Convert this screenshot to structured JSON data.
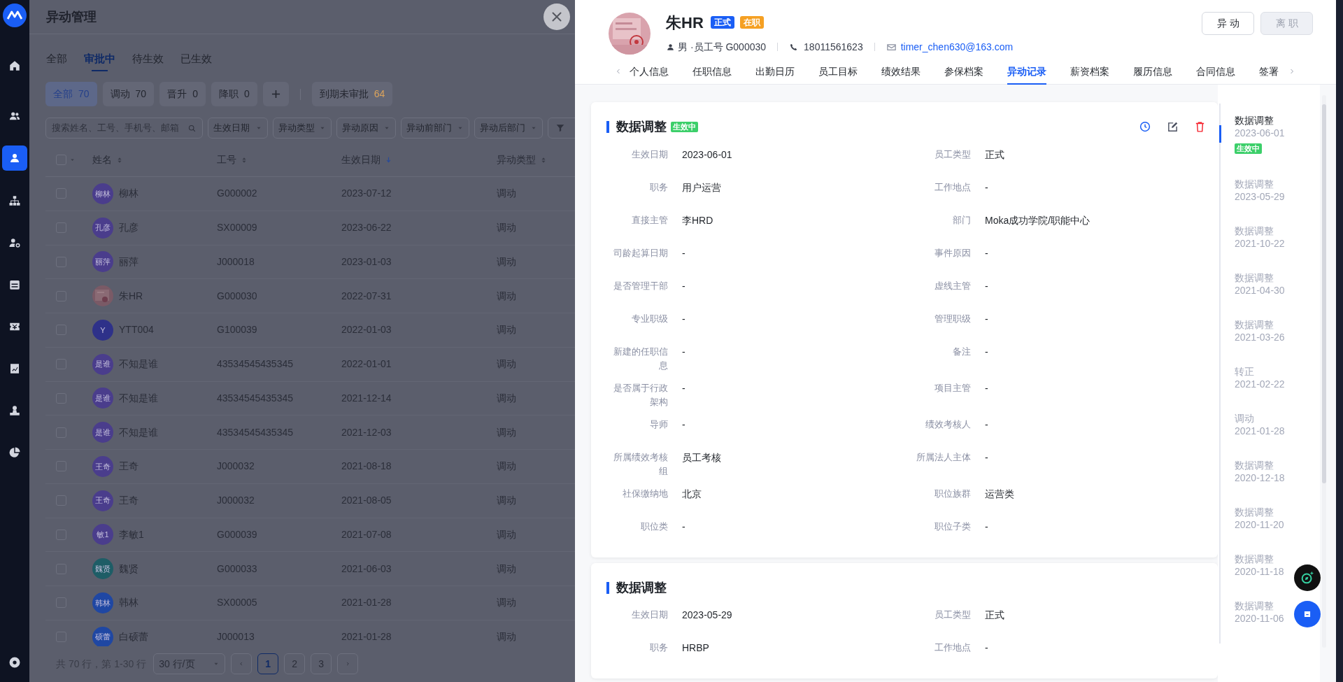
{
  "sidebar": {
    "items": [
      {
        "selected": false
      },
      {
        "selected": false
      },
      {
        "selected": true
      },
      {
        "selected": false
      },
      {
        "selected": false
      },
      {
        "selected": false
      },
      {
        "selected": false
      },
      {
        "selected": false
      },
      {
        "selected": false
      },
      {
        "selected": false
      },
      {
        "selected": false
      }
    ]
  },
  "page": {
    "title": "异动管理",
    "tabs": [
      {
        "label": "全部",
        "selected": false
      },
      {
        "label": "审批中",
        "selected": true
      },
      {
        "label": "待生效",
        "selected": false
      },
      {
        "label": "已生效",
        "selected": false
      }
    ],
    "chips": [
      {
        "label": "全部",
        "count": "70",
        "selected": true,
        "kind": "normal"
      },
      {
        "label": "调动",
        "count": "70",
        "selected": false,
        "kind": "normal"
      },
      {
        "label": "晋升",
        "count": "0",
        "selected": false,
        "kind": "normal"
      },
      {
        "label": "降职",
        "count": "0",
        "selected": false,
        "kind": "normal"
      },
      {
        "label": "到期未审批",
        "count": "64",
        "selected": false,
        "kind": "warning"
      }
    ],
    "search": {
      "placeholder": "搜索姓名、工号、手机号、邮箱"
    },
    "filters": [
      "生效日期",
      "异动类型",
      "异动原因",
      "异动前部门",
      "异动后部门"
    ],
    "table": {
      "select_all": {
        "checked": false
      },
      "columns": [
        {
          "label": "姓名",
          "kind": "sortable"
        },
        {
          "label": "工号",
          "kind": "sortable"
        },
        {
          "label": "生效日期",
          "kind": "sorted"
        },
        {
          "label": "异动类型",
          "kind": "sortable"
        }
      ],
      "rows": [
        {
          "checked": false,
          "avatar": "柳林",
          "color": "#4a3d8c",
          "name": "柳林",
          "id": "G000002",
          "date": "2023-07-12",
          "type": "调动"
        },
        {
          "checked": false,
          "avatar": "孔彦",
          "color": "#4a3d8c",
          "name": "孔彦",
          "id": "SX00009",
          "date": "2023-06-22",
          "type": "调动"
        },
        {
          "checked": false,
          "avatar": "丽萍",
          "color": "#4a3d8c",
          "name": "丽萍",
          "id": "J000018",
          "date": "2023-01-03",
          "type": "调动"
        },
        {
          "checked": false,
          "kind": "picture",
          "name": "朱HR",
          "id": "G000030",
          "date": "2022-07-31",
          "type": "调动"
        },
        {
          "checked": false,
          "avatar": "Y",
          "color": "#2e3189",
          "name": "YTT004",
          "id": "G100039",
          "date": "2022-01-03",
          "type": "调动"
        },
        {
          "checked": false,
          "avatar": "是谁",
          "color": "#4a3d8c",
          "name": "不知是谁",
          "id": "43534545435345",
          "date": "2022-01-01",
          "type": "调动"
        },
        {
          "checked": false,
          "avatar": "是谁",
          "color": "#4a3d8c",
          "name": "不知是谁",
          "id": "43534545435345",
          "date": "2021-12-14",
          "type": "调动"
        },
        {
          "checked": false,
          "avatar": "是谁",
          "color": "#4a3d8c",
          "name": "不知是谁",
          "id": "43534545435345",
          "date": "2021-12-03",
          "type": "调动"
        },
        {
          "checked": false,
          "avatar": "王奇",
          "color": "#4a3d8c",
          "name": "王奇",
          "id": "J000032",
          "date": "2021-08-18",
          "type": "调动"
        },
        {
          "checked": false,
          "avatar": "王奇",
          "color": "#4a3d8c",
          "name": "王奇",
          "id": "J000032",
          "date": "2021-08-05",
          "type": "调动"
        },
        {
          "checked": false,
          "avatar": "敏1",
          "color": "#4a3d8c",
          "name": "李敏1",
          "id": "G000039",
          "date": "2021-07-08",
          "type": "调动"
        },
        {
          "checked": false,
          "avatar": "魏贤",
          "color": "#1e5d66",
          "name": "魏贤",
          "id": "G000033",
          "date": "2021-06-03",
          "type": "调动"
        },
        {
          "checked": false,
          "avatar": "韩林",
          "color": "#1f47a3",
          "name": "韩林",
          "id": "SX00005",
          "date": "2021-01-28",
          "type": "调动"
        },
        {
          "checked": false,
          "avatar": "硕蕾",
          "color": "#1f47a3",
          "name": "白硕蕾",
          "id": "J000013",
          "date": "2021-01-28",
          "type": "调动"
        }
      ]
    },
    "pagination": {
      "summary": "共 70 行，第 1-30 行",
      "page_size": "30 行/页",
      "pages": [
        {
          "label": "1",
          "selected": true
        },
        {
          "label": "2",
          "selected": false
        },
        {
          "label": "3",
          "selected": false
        }
      ]
    }
  },
  "drawer": {
    "name": "朱HR",
    "tags": [
      {
        "label": "正式",
        "color": "#1a5ef5"
      },
      {
        "label": "在职",
        "color": "#f5a023"
      }
    ],
    "info": "男 ·员工号 G000030",
    "phone": "18011561623",
    "email": "timer_chen630@163.com",
    "actions": [
      {
        "label": "异动",
        "disabled": false
      },
      {
        "label": "离职",
        "disabled": true
      }
    ],
    "tabs": [
      {
        "label": "个人信息",
        "selected": false
      },
      {
        "label": "任职信息",
        "selected": false
      },
      {
        "label": "出勤日历",
        "selected": false
      },
      {
        "label": "员工目标",
        "selected": false
      },
      {
        "label": "绩效结果",
        "selected": false
      },
      {
        "label": "参保档案",
        "selected": false
      },
      {
        "label": "异动记录",
        "selected": true
      },
      {
        "label": "薪资档案",
        "selected": false
      },
      {
        "label": "履历信息",
        "selected": false
      },
      {
        "label": "合同信息",
        "selected": false
      },
      {
        "label": "签署",
        "selected": false
      }
    ],
    "records": [
      {
        "title": "数据调整",
        "badge": "生效中",
        "show_actions": true,
        "fields": [
          {
            "label": "生效日期",
            "value": "2023-06-01"
          },
          {
            "label": "员工类型",
            "value": "正式"
          },
          {
            "label": "职务",
            "value": "用户运营"
          },
          {
            "label": "工作地点",
            "value": "-"
          },
          {
            "label": "直接主管",
            "value": "李HRD"
          },
          {
            "label": "部门",
            "value": "Moka成功学院/职能中心"
          },
          {
            "label": "司龄起算日期",
            "value": "-"
          },
          {
            "label": "事件原因",
            "value": "-"
          },
          {
            "label": "是否管理干部",
            "value": "-"
          },
          {
            "label": "虚线主管",
            "value": "-"
          },
          {
            "label": "专业职级",
            "value": "-"
          },
          {
            "label": "管理职级",
            "value": "-"
          },
          {
            "label": "新建的任职信息",
            "value": "-"
          },
          {
            "label": "备注",
            "value": "-"
          },
          {
            "label": "是否属于行政架构",
            "value": "-"
          },
          {
            "label": "项目主管",
            "value": "-"
          },
          {
            "label": "导师",
            "value": "-"
          },
          {
            "label": "绩效考核人",
            "value": "-"
          },
          {
            "label": "所属绩效考核组",
            "value": "员工考核"
          },
          {
            "label": "所属法人主体",
            "value": "-"
          },
          {
            "label": "社保缴纳地",
            "value": "北京"
          },
          {
            "label": "职位族群",
            "value": "运营类"
          },
          {
            "label": "职位类",
            "value": "-"
          },
          {
            "label": "职位子类",
            "value": "-"
          }
        ]
      },
      {
        "title": "数据调整",
        "show_actions": false,
        "fields": [
          {
            "label": "生效日期",
            "value": "2023-05-29"
          },
          {
            "label": "员工类型",
            "value": "正式"
          },
          {
            "label": "职务",
            "value": "HRBP"
          },
          {
            "label": "工作地点",
            "value": "-"
          }
        ]
      }
    ],
    "timeline": [
      {
        "title": "数据调整",
        "date": "2023-06-01",
        "badge": "生效中",
        "selected": true
      },
      {
        "title": "数据调整",
        "date": "2023-05-29",
        "selected": false
      },
      {
        "title": "数据调整",
        "date": "2021-10-22",
        "selected": false
      },
      {
        "title": "数据调整",
        "date": "2021-04-30",
        "selected": false
      },
      {
        "title": "数据调整",
        "date": "2021-03-26",
        "selected": false
      },
      {
        "title": "转正",
        "date": "2021-02-22",
        "selected": false
      },
      {
        "title": "调动",
        "date": "2021-01-28",
        "selected": false
      },
      {
        "title": "数据调整",
        "date": "2020-12-18",
        "selected": false
      },
      {
        "title": "数据调整",
        "date": "2020-11-20",
        "selected": false
      },
      {
        "title": "数据调整",
        "date": "2020-11-18",
        "selected": false
      },
      {
        "title": "数据调整",
        "date": "2020-11-06",
        "selected": false
      }
    ]
  }
}
